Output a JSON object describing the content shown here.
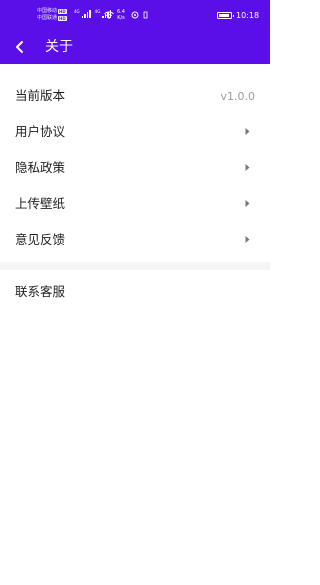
{
  "status_bar": {
    "carrier_1": "中国移动",
    "carrier_2": "中国联通",
    "hd_badge": "HD",
    "signal_1_label": "4G",
    "signal_2_label": "4G",
    "speed_value": "6.4",
    "speed_unit": "K/s",
    "time": "10:18"
  },
  "app_bar": {
    "title": "关于"
  },
  "list": {
    "items": [
      {
        "label": "当前版本",
        "value": "v1.0.0"
      },
      {
        "label": "用户协议"
      },
      {
        "label": "隐私政策"
      },
      {
        "label": "上传壁纸"
      },
      {
        "label": "意见反馈"
      }
    ],
    "contact": {
      "label": "联系客服"
    }
  },
  "colors": {
    "primary": "#5b0fe8",
    "text": "#1f1f1f",
    "muted": "#9a9a9a",
    "divider": "#f5f5f5"
  },
  "icons": {
    "back": "arrow-left-icon",
    "chevron": "chevron-right-icon",
    "wifi": "wifi-icon",
    "battery": "battery-icon"
  }
}
